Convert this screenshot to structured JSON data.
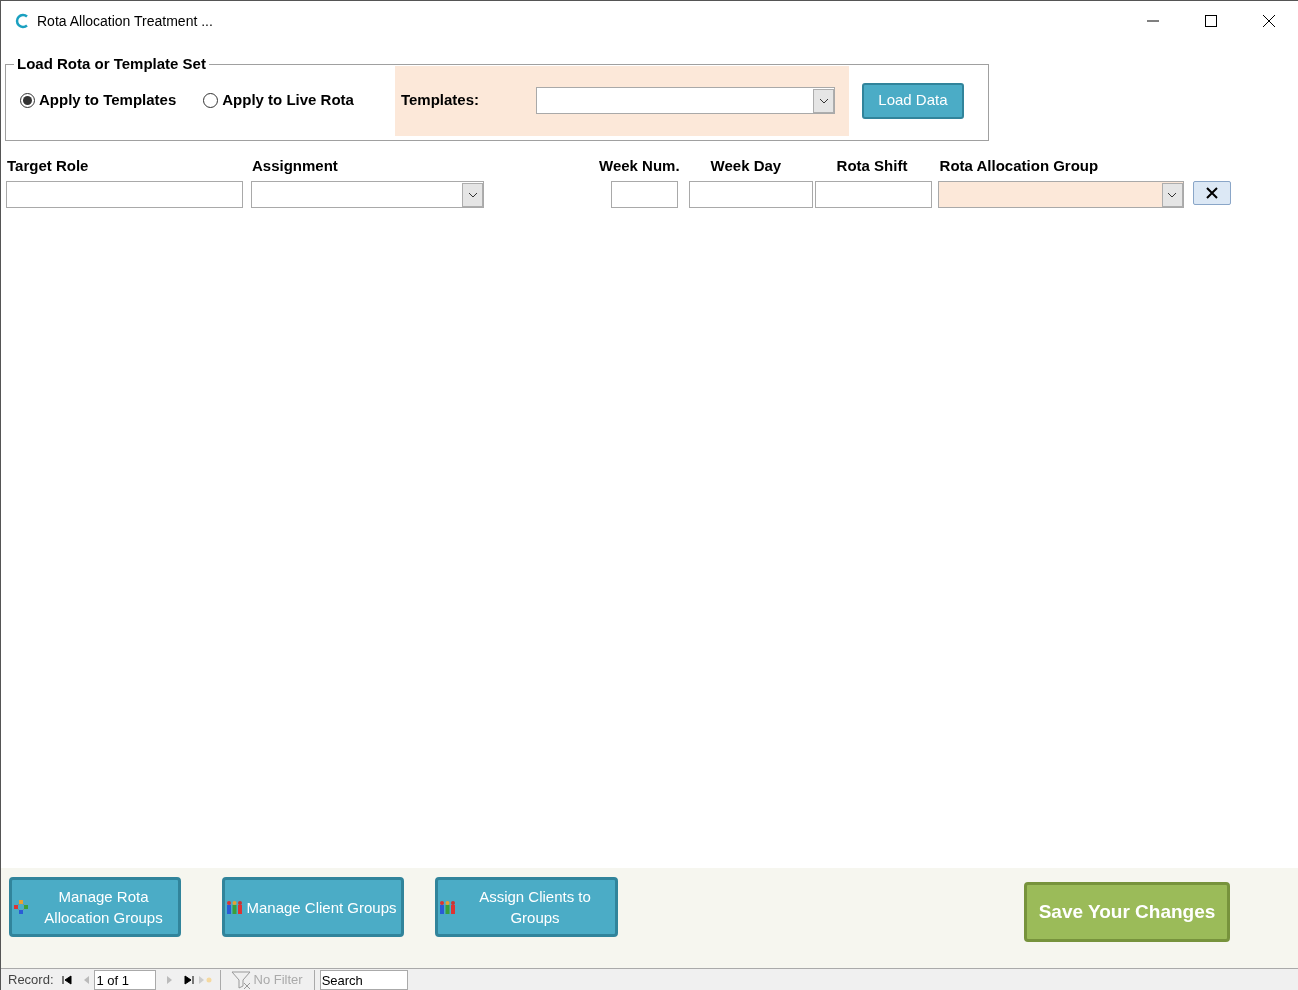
{
  "window": {
    "title": "Rota Allocation Treatment ..."
  },
  "load_group": {
    "legend": "Load Rota or Template Set",
    "radios": [
      {
        "label": "Apply to Templates",
        "selected": true
      },
      {
        "label": "Apply to Live Rota",
        "selected": false
      }
    ],
    "templates_label": "Templates:",
    "load_button": "Load Data"
  },
  "fields": [
    {
      "label": "Target Role",
      "kind": "text",
      "highlighted": false
    },
    {
      "label": "Assignment",
      "kind": "dropdown",
      "highlighted": false
    },
    {
      "label": "Week Num.",
      "kind": "text",
      "highlighted": false
    },
    {
      "label": "Week Day",
      "kind": "text",
      "highlighted": false
    },
    {
      "label": "Rota Shift",
      "kind": "text",
      "highlighted": false
    },
    {
      "label": "Rota Allocation Group",
      "kind": "dropdown",
      "highlighted": true
    }
  ],
  "footer_buttons": [
    {
      "label": "Manage Rota Allocation Groups",
      "kind": "nodes"
    },
    {
      "label": "Manage Client Groups",
      "kind": "people"
    },
    {
      "label": "Assign Clients to Groups",
      "kind": "people"
    }
  ],
  "save_button": "Save Your Changes",
  "navigator": {
    "record_label": "Record:",
    "position": "1 of 1",
    "filter": "No Filter",
    "search": "Search"
  }
}
